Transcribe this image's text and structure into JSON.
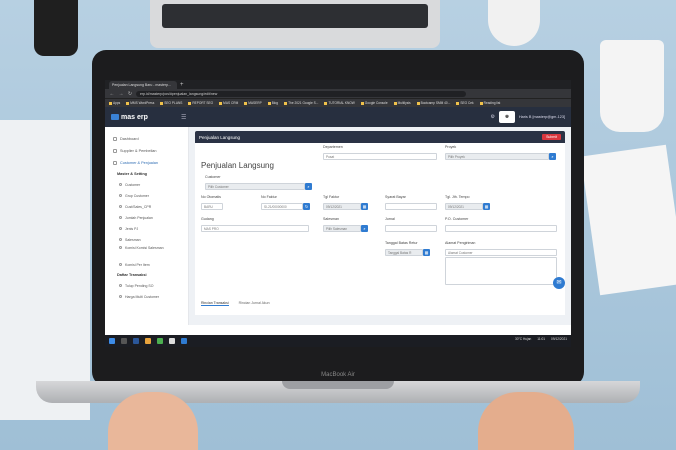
{
  "scene": {
    "laptop_brand": "MacBook Air"
  },
  "browser": {
    "tab_title": "Penjualan Langsung Baru - masterp...",
    "url": "erp.id/masterp/pos/#penjualan_langsung/edit/new",
    "bookmarks": [
      "Apps",
      "MMS WordPress",
      "SEO PLANS",
      "REPORT SEO",
      "MAS CRM",
      "MASERP",
      "Blog",
      "The 2021 Google S...",
      "TUTORIAL KNOW",
      "Google Console",
      "Multilysis",
      "Bootcamp SMM 40...",
      "SEO Cek",
      "Reading list"
    ]
  },
  "app": {
    "logo": "mas erp",
    "user_name": "Haris B [masterp@gm-123]",
    "sidebar": {
      "items": [
        "Dashboard",
        "Supplier & Pembelian",
        "Customer & Penjualan"
      ],
      "section_master": "Master & Setting",
      "master_items": [
        "Customer",
        "Grup Customer",
        "Cust/Sales_CPR",
        "Jumlah Penjualan",
        "Jenis PJ",
        "Salesman",
        "Komisi Komisi Salesman",
        "Komisi Per Item"
      ],
      "section_daftar": "Daftar Transaksi",
      "daftar_items": [
        "Tulup Pending SO",
        "Harga Multi Customer"
      ]
    },
    "panel": {
      "title": "Penjualan Langsung",
      "submit": "Submit",
      "form_title": "Penjualan Langsung"
    },
    "form": {
      "departemen_label": "Departemen",
      "departemen_value": "Pusat",
      "proyek_label": "Proyek",
      "proyek_value": "Pilih Proyek",
      "customer_label": "Customer",
      "customer_value": "Pilih Customer",
      "no_otomatis_label": "No Otomatis",
      "no_otomatis_value": "BARU",
      "no_faktur_label": "No Faktur",
      "no_faktur_value": "SI-21/00000000",
      "tgl_faktur_label": "Tgl Faktur",
      "tgl_faktur_value": "09/12/2021",
      "syarat_label": "Syarat Bayar",
      "tgl_tempo_label": "Tgl. Jth. Tempo",
      "tgl_tempo_value": "09/12/2021",
      "gudang_label": "Gudang",
      "gudang_value": "MAS PRO",
      "salesman_label": "Salesman",
      "salesman_value": "Pilih Salesman",
      "jurnal_label": "Jurnal",
      "po_label": "P.O. Customer",
      "tgl_retur_label": "Tanggal Batas Retur",
      "tgl_retur_value": "Tanggal Batas R",
      "alamat_label": "Alamat Pengiriman",
      "alamat_value": "Alamat Customer"
    },
    "tabs": [
      "Rincian Transaksi",
      "Rincian Jurnal Akun"
    ]
  },
  "taskbar": {
    "weather": "30°C Hujan",
    "time": "11:01",
    "date": "09/12/2021"
  }
}
